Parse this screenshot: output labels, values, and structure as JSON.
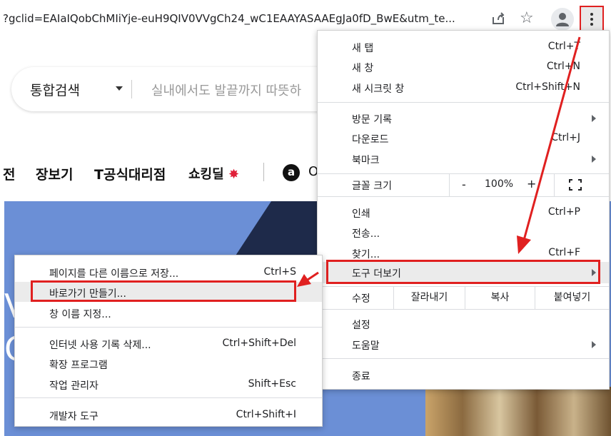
{
  "address_bar": {
    "url": "?gclid=EAIaIQobChMIiYje-euH9QIV0VVgCh24_wC1EAAYASAAEgJa0fD_BwE&utm_te..."
  },
  "page": {
    "search": {
      "category": "통합검색",
      "placeholder": "실내에서도 발끝까지 따뜻하"
    },
    "nav": [
      "전",
      "장보기",
      "T공식대리점"
    ],
    "shocking_deal": "쇼킹딜",
    "amazon_badge": "a",
    "amazon_text": "O",
    "banner_text_1": "V",
    "banner_text_2": "O"
  },
  "chrome_menu": {
    "items": [
      {
        "label": "새 탭",
        "shortcut": "Ctrl+T"
      },
      {
        "label": "새 창",
        "shortcut": "Ctrl+N"
      },
      {
        "label": "새 시크릿 창",
        "shortcut": "Ctrl+Shift+N"
      },
      {
        "label": "방문 기록",
        "shortcut": ""
      },
      {
        "label": "다운로드",
        "shortcut": "Ctrl+J"
      },
      {
        "label": "북마크",
        "shortcut": ""
      },
      {
        "label": "인쇄",
        "shortcut": "Ctrl+P"
      },
      {
        "label": "전송...",
        "shortcut": ""
      },
      {
        "label": "찾기...",
        "shortcut": "Ctrl+F"
      },
      {
        "label": "도구 더보기",
        "shortcut": ""
      },
      {
        "label": "설정",
        "shortcut": ""
      },
      {
        "label": "도움말",
        "shortcut": ""
      },
      {
        "label": "종료",
        "shortcut": ""
      }
    ],
    "zoom": {
      "label": "글꼴 크기",
      "minus": "-",
      "value": "100%",
      "plus": "+"
    },
    "edit": {
      "label": "수정",
      "cut": "잘라내기",
      "copy": "복사",
      "paste": "붙여넣기"
    }
  },
  "sub_menu": {
    "items": [
      {
        "label": "페이지를 다른 이름으로 저장...",
        "shortcut": "Ctrl+S"
      },
      {
        "label": "바로가기 만들기...",
        "shortcut": ""
      },
      {
        "label": "창 이름 지정...",
        "shortcut": ""
      },
      {
        "label": "인터넷 사용 기록 삭제...",
        "shortcut": "Ctrl+Shift+Del"
      },
      {
        "label": "확장 프로그램",
        "shortcut": ""
      },
      {
        "label": "작업 관리자",
        "shortcut": "Shift+Esc"
      },
      {
        "label": "개발자 도구",
        "shortcut": "Ctrl+Shift+I"
      }
    ]
  },
  "colors": {
    "highlight_box": "#e02020",
    "banner": "#6b8fd6"
  }
}
